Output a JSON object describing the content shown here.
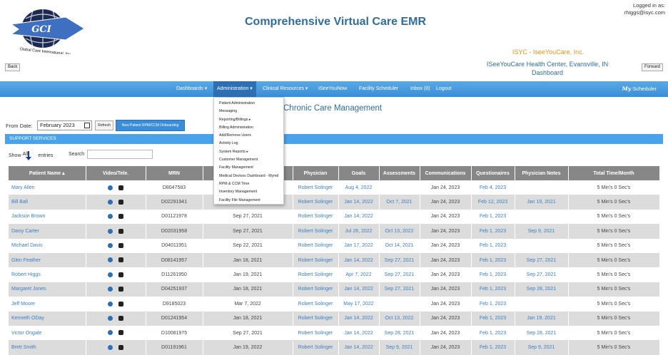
{
  "header": {
    "app_title": "Comprehensive Virtual Care EMR",
    "logged_in_label": "Logged in as:",
    "logged_in_user": "rhiggs@isyc.com",
    "org_name": "ISYC - IseeYouCare, Inc.",
    "center_name": "ISeeYouCare Health Center, Evansville, IN",
    "center_sub": "Dashboard",
    "back_label": "Back",
    "forward_label": "Forward",
    "logo_text": "GCI",
    "logo_caption": "Global Care International, Inc."
  },
  "nav": {
    "items": [
      "Dashboards ▾",
      "Administration ▾",
      "Clinical Resources ▾",
      "ISeeYouNow",
      "Facility Scheduler",
      "Inbox (0)",
      "Logout"
    ],
    "scheduler_prefix": "My",
    "scheduler_label": "Scheduler"
  },
  "dropdown": {
    "items": [
      "Patient Administration",
      "Messaging",
      "Reporting/Billings ▸",
      "Billing Administration",
      "Add/Remove Users",
      "Activity Log",
      "System Reports ▸",
      "Customer Management",
      "Facility Management",
      "Medical Devices Dashboard - Mymd",
      "RPM & CCM Time",
      "Inventory Management",
      "Facility File Management"
    ]
  },
  "page_heading": "Chronic Care Management",
  "filters": {
    "from_date_label": "From Date:",
    "from_date_value": "February 2023",
    "refresh_label": "Refresh",
    "onboard_label": "New Patient RPM/CCM Onboarding"
  },
  "support_title": "SUPPORT SERVICES",
  "table_controls": {
    "show_label": "Show",
    "show_value": "All",
    "entries_label": "entries",
    "search_label": "Search"
  },
  "columns": [
    "Patient Name ▴",
    "Video/Tele.",
    "MRN",
    "",
    "Physician",
    "Goals",
    "Assessments",
    "Communications",
    "Questionaires",
    "Physician Notes",
    "Total Time/Month"
  ],
  "rows": [
    {
      "name": "Mary Allen",
      "mrn": "D8047583",
      "date": "",
      "physician": "Robert Solinger",
      "goals": "Aug 4, 2022",
      "assess": "",
      "comm": "Jan 24, 2023",
      "quest": "Feb 4, 2023",
      "notes": "",
      "time": "5 Min's 0 Sec's"
    },
    {
      "name": "Bill Ball",
      "mrn": "D02291941",
      "date": "",
      "physician": "Robert Solinger",
      "goals": "Jan 14, 2022",
      "assess": "Oct 7, 2021",
      "comm": "Jan 24, 2023",
      "quest": "Feb 12, 2023",
      "notes": "Jan 19, 2021",
      "time": "5 Min's 0 Sec's"
    },
    {
      "name": "Jackson Brown",
      "mrn": "D01121978",
      "date": "Sep 27, 2021",
      "physician": "Robert Solinger",
      "goals": "Jan 14, 2022",
      "assess": "",
      "comm": "Jan 24, 2023",
      "quest": "Feb 1, 2023",
      "notes": "",
      "time": "5 Min's 0 Sec's"
    },
    {
      "name": "Daisy Carter",
      "mrn": "D02031958",
      "date": "Sep 27, 2021",
      "physician": "Robert Solinger",
      "goals": "Jul 26, 2022",
      "assess": "Oct 13, 2022",
      "comm": "Jan 24, 2023",
      "quest": "Feb 1, 2023",
      "notes": "Sep 9, 2021",
      "time": "5 Min's 0 Sec's"
    },
    {
      "name": "Michael Davis",
      "mrn": "D04011951",
      "date": "Sep 22, 2021",
      "physician": "Robert Solinger",
      "goals": "Jan 17, 2022",
      "assess": "Oct 14, 2021",
      "comm": "Jan 24, 2023",
      "quest": "Feb 1, 2023",
      "notes": "",
      "time": "5 Min's 0 Sec's"
    },
    {
      "name": "Glen Feather",
      "mrn": "D08141957",
      "date": "Jan 18, 2021",
      "physician": "Robert Solinger",
      "goals": "Jan 14, 2022",
      "assess": "Sep 27, 2021",
      "comm": "Jan 24, 2023",
      "quest": "Feb 1, 2023",
      "notes": "Sep 27, 2021",
      "time": "5 Min's 0 Sec's"
    },
    {
      "name": "Robert Higgs",
      "mrn": "D11261950",
      "date": "Jan 19, 2021",
      "physician": "Robert Solinger",
      "goals": "Apr 7, 2022",
      "assess": "Sep 27, 2021",
      "comm": "Jan 24, 2023",
      "quest": "Feb 1, 2023",
      "notes": "Sep 27, 2021",
      "time": "5 Min's 0 Sec's"
    },
    {
      "name": "Margaret Jones",
      "mrn": "D04251937",
      "date": "Jan 18, 2021",
      "physician": "Robert Solinger",
      "goals": "Jan 14, 2022",
      "assess": "Sep 27, 2021",
      "comm": "Jan 24, 2023",
      "quest": "Feb 1, 2023",
      "notes": "Sep 28, 2021",
      "time": "5 Min's 0 Sec's"
    },
    {
      "name": "Jeff Moore",
      "mrn": "D9185023",
      "date": "Mar 7, 2022",
      "physician": "Robert Solinger",
      "goals": "May 17, 2022",
      "assess": "",
      "comm": "Jan 24, 2023",
      "quest": "Feb 1, 2023",
      "notes": "",
      "time": "5 Min's 0 Sec's"
    },
    {
      "name": "Kenneth ODay",
      "mrn": "D01241954",
      "date": "Jan 18, 2021",
      "physician": "Robert Solinger",
      "goals": "Jan 14, 2022",
      "assess": "Oct 13, 2022",
      "comm": "Jan 24, 2023",
      "quest": "Feb 1, 2023",
      "notes": "Jan 19, 2021",
      "time": "5 Min's 0 Sec's"
    },
    {
      "name": "Victor Ongale",
      "mrn": "D10081975",
      "date": "Sep 27, 2021",
      "physician": "Robert Solinger",
      "goals": "Jan 14, 2022",
      "assess": "Sep 28, 2021",
      "comm": "Jan 24, 2023",
      "quest": "Feb 1, 2023",
      "notes": "Sep 28, 2021",
      "time": "5 Min's 0 Sec's"
    },
    {
      "name": "Brett Smith",
      "mrn": "D01191961",
      "date": "Jan 19, 2022",
      "physician": "Robert Solinger",
      "goals": "Jan 14, 2022",
      "assess": "Sep 9, 2021",
      "comm": "Jan 24, 2023",
      "quest": "Feb 1, 2023",
      "notes": "Sep 9, 2021",
      "time": "5 Min's 0 Sec's"
    }
  ],
  "colors": {
    "nav": "#3a8ed8",
    "title": "#2e6d9e",
    "org": "#f0901a",
    "link": "#3a7fc4",
    "header_row": "#878787"
  }
}
